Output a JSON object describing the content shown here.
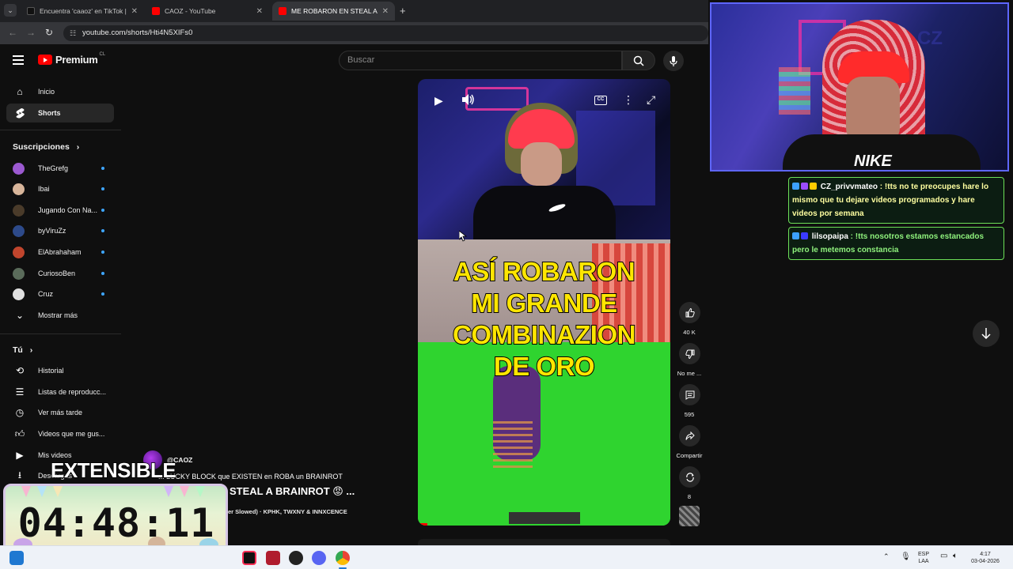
{
  "browser": {
    "tabs": [
      {
        "title": "Encuentra 'caaoz' en TikTok | Bú",
        "favicon_color": "#111111"
      },
      {
        "title": "CAOZ - YouTube",
        "favicon_color": "#ff0000"
      },
      {
        "title": "ME ROBARON EN STEAL A BRAI",
        "favicon_color": "#ff0000",
        "active": true
      }
    ],
    "close_glyph": "✕",
    "new_tab_glyph": "+",
    "url": "youtube.com/shorts/Hti4N5XIFs0"
  },
  "youtube": {
    "brand": "Premium",
    "region": "CL",
    "search_placeholder": "Buscar",
    "sidebar": {
      "main": [
        {
          "label": "Inicio",
          "icon": "home-icon"
        },
        {
          "label": "Shorts",
          "icon": "shorts-icon",
          "active": true
        }
      ],
      "subs_header": "Suscripciones",
      "subscriptions": [
        {
          "label": "TheGrefg",
          "color": "#9b59d0"
        },
        {
          "label": "Ibai",
          "color": "#d8b59a"
        },
        {
          "label": "Jugando Con Na...",
          "color": "#4a3b2a"
        },
        {
          "label": "byViruZz",
          "color": "#2d4a8a"
        },
        {
          "label": "ElAbrahaham",
          "color": "#c0452d"
        },
        {
          "label": "CuriosoBen",
          "color": "#5a6b5a"
        },
        {
          "label": "Cruz",
          "color": "#e0e0e0"
        }
      ],
      "show_more": "Mostrar más",
      "you_header": "Tú",
      "you_items": [
        {
          "label": "Historial",
          "icon": "history-icon"
        },
        {
          "label": "Listas de reproducc...",
          "icon": "playlist-icon"
        },
        {
          "label": "Ver más tarde",
          "icon": "clock-icon"
        },
        {
          "label": "Videos que me gus...",
          "icon": "like-icon"
        },
        {
          "label": "Mis videos",
          "icon": "video-icon"
        },
        {
          "label": "Descargas",
          "icon": "download-icon"
        }
      ]
    },
    "short": {
      "caption_lines": [
        "ASÍ ROBARON",
        "MI GRANDE",
        "COMBINAZION",
        "DE ORO"
      ],
      "channel": "@CAOZ",
      "title_top": "... LUCKY BLOCK que EXISTEN en ROBA un BRAINROT",
      "title": "STEAL A BRAINROT 😡 ...",
      "song": "er Slowed) · KPHK, TWXNY & INNXCENCE",
      "actions": [
        {
          "label": "40 K",
          "icon": "thumbs-up-icon"
        },
        {
          "label": "No me ...",
          "icon": "thumbs-down-icon"
        },
        {
          "label": "595",
          "icon": "comment-icon"
        },
        {
          "label": "Compartir",
          "icon": "share-icon"
        },
        {
          "label": "8",
          "icon": "remix-icon"
        }
      ]
    }
  },
  "stream_overlay": {
    "chat": [
      {
        "user": "CZ_privvmateo",
        "message": " : !tts no te preocupes hare lo mismo que tu dejare videos programados y hare videos por semana"
      },
      {
        "user": "lilsopaipa",
        "message": " : !tts nosotros estamos estancados pero le metemos constancia"
      }
    ],
    "timer_title": "EXTENSIBLE",
    "timer": "04:48:11"
  },
  "taskbar": {
    "language": "ESP",
    "layout": "LAA",
    "time": "4:17",
    "date": "03-04-2026"
  }
}
